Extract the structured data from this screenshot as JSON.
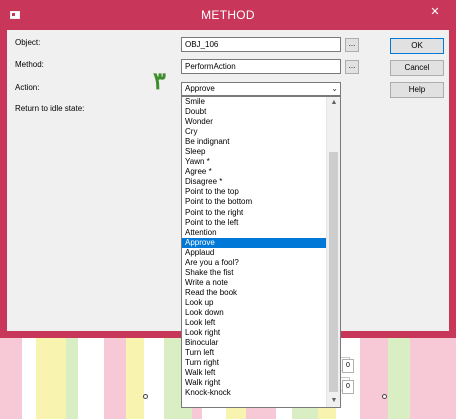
{
  "window": {
    "title": "METHOD",
    "close_glyph": "✕"
  },
  "form": {
    "object_label": "Object:",
    "object_value": "OBJ_106",
    "method_label": "Method:",
    "method_value": "PerformAction",
    "action_label": "Action:",
    "action_value": "Approve",
    "return_label": "Return to idle state:",
    "browse_glyph": "..."
  },
  "buttons": {
    "ok": "OK",
    "cancel": "Cancel",
    "help": "Help"
  },
  "annotation": "٣",
  "action_options": [
    "Smile",
    "Doubt",
    "Wonder",
    "Cry",
    "Be indignant",
    "Sleep",
    "Yawn *",
    "Agree *",
    "Disagree *",
    "Point to the top",
    "Point to the bottom",
    "Point to the right",
    "Point to the left",
    "Attention",
    "Approve",
    "Applaud",
    "Are you a fool?",
    "Shake the fist",
    "Write a note",
    "Read the book",
    "Look up",
    "Look down",
    "Look left",
    "Look right",
    "Binocular",
    "Turn left",
    "Turn right",
    "Walk left",
    "Walk right",
    "Knock-knock"
  ],
  "selected_option": "Approve",
  "background_spin_values": [
    "0",
    "0"
  ],
  "colors": {
    "titlebar": "#c8375a",
    "selection": "#0078d7",
    "annotation": "#3e8e2c"
  }
}
